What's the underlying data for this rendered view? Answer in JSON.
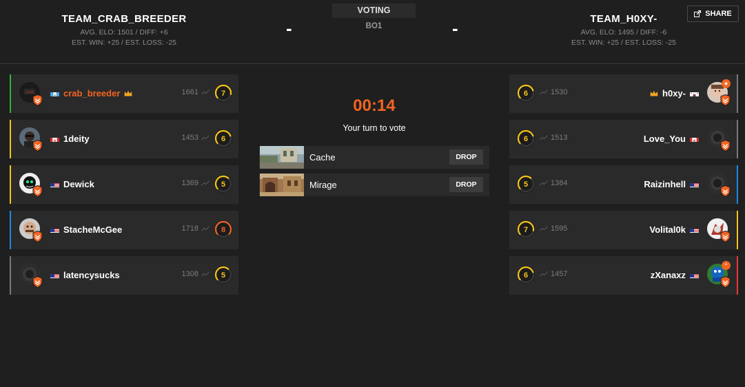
{
  "header": {
    "team_left": {
      "name": "TEAM_CRAB_BREEDER",
      "avg": "AVG. ELO: 1501 / DIFF: +6",
      "est": "EST. WIN: +25 / EST. LOSS: -25"
    },
    "team_right": {
      "name": "TEAM_H0XY-",
      "avg": "AVG. ELO: 1495 / DIFF: -6",
      "est": "EST. WIN: +25 / EST. LOSS: -25"
    },
    "dash": "-",
    "status_label": "VOTING",
    "format": "BO1",
    "share_label": "SHARE"
  },
  "voting": {
    "timer": "00:14",
    "prompt": "Your turn to vote",
    "maps": [
      {
        "name": "Cache",
        "action": "DROP"
      },
      {
        "name": "Mirage",
        "action": "DROP"
      }
    ]
  },
  "team_left_players": [
    {
      "name": "crab_breeder",
      "elo": "1661",
      "level": "7",
      "flag": "gt",
      "accent": "#2eb82e"
    },
    {
      "name": "1deity",
      "elo": "1453",
      "level": "6",
      "flag": "ca",
      "accent": "#f5c518"
    },
    {
      "name": "Dewick",
      "elo": "1369",
      "level": "5",
      "flag": "us",
      "accent": "#f5c518"
    },
    {
      "name": "StacheMcGee",
      "elo": "1718",
      "level": "8",
      "flag": "us",
      "accent": "#1e88e5"
    },
    {
      "name": "latencysucks",
      "elo": "1308",
      "level": "5",
      "flag": "us",
      "accent": "#7a7a7a"
    }
  ],
  "team_right_players": [
    {
      "name": "h0xy-",
      "elo": "1530",
      "level": "6",
      "flag": "kr",
      "accent": "#7a7a7a"
    },
    {
      "name": "Love_You",
      "elo": "1513",
      "level": "6",
      "flag": "ca",
      "accent": "#7a7a7a"
    },
    {
      "name": "Raizinhell",
      "elo": "1384",
      "level": "5",
      "flag": "us",
      "accent": "#1e88e5"
    },
    {
      "name": "Volital0k",
      "elo": "1595",
      "level": "7",
      "flag": "us",
      "accent": "#f5c518"
    },
    {
      "name": "zXanaxz",
      "elo": "1457",
      "level": "6",
      "flag": "us",
      "accent": "#e53935"
    }
  ],
  "colors": {
    "accent_orange": "#f26422",
    "level_yellow": "#f5c518",
    "level_orange": "#f26422"
  }
}
